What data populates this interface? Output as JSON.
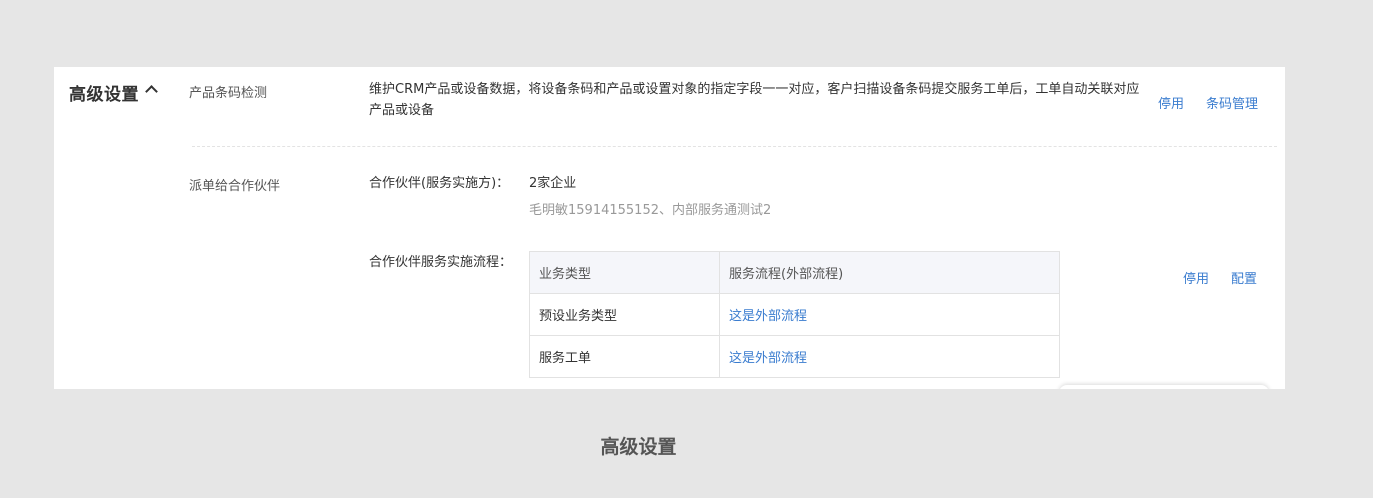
{
  "section": {
    "title": "高级设置"
  },
  "barcode": {
    "label": "产品条码检测",
    "description": "维护CRM产品或设备数据，将设备条码和产品或设置对象的指定字段一一对应，客户扫描设备条码提交服务工单后，工单自动关联对应产品或设备",
    "disable_label": "停用",
    "manage_label": "条码管理"
  },
  "dispatch": {
    "label": "派单给合作伙伴",
    "partner_label": "合作伙伴(服务实施方)：",
    "partner_count": "2家企业",
    "partner_names": "毛明敏15914155152、内部服务通测试2",
    "flow_label": "合作伙伴服务实施流程：",
    "table": {
      "headers": [
        "业务类型",
        "服务流程(外部流程)"
      ],
      "rows": [
        [
          "预设业务类型",
          "这是外部流程"
        ],
        [
          "服务工单",
          "这是外部流程"
        ]
      ]
    },
    "disable_label": "停用",
    "config_label": "配置"
  },
  "caption": "高级设置",
  "colors": {
    "link": "#3a7ccf",
    "background": "#e6e6e6",
    "card": "#ffffff"
  }
}
